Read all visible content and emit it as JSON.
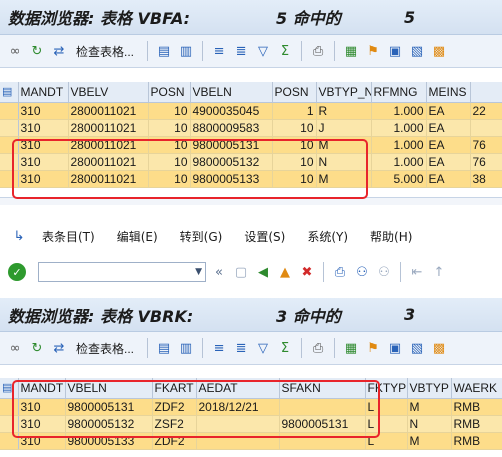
{
  "top": {
    "title": {
      "prefix": "数据浏览器: 表格 VBFA:",
      "count": "5 命中的",
      "total": "5"
    },
    "toolbar": {
      "check_table_label": "检查表格..."
    },
    "columns": [
      "",
      "MANDT",
      "VBELV",
      "POSN",
      "VBELN",
      "POSN",
      "VBTYP_N",
      "RFMNG",
      "MEINS",
      ""
    ],
    "rows": [
      {
        "mandt": "310",
        "vbelv": "2800011021",
        "posnv": "10",
        "vbeln": "4900035045",
        "posnn": "1",
        "vbtyp": "R",
        "rfmng": "1.000",
        "meins": "EA",
        "extra": "22"
      },
      {
        "mandt": "310",
        "vbelv": "2800011021",
        "posnv": "10",
        "vbeln": "8800009583",
        "posnn": "10",
        "vbtyp": "J",
        "rfmng": "1.000",
        "meins": "EA",
        "extra": ""
      },
      {
        "mandt": "310",
        "vbelv": "2800011021",
        "posnv": "10",
        "vbeln": "9800005131",
        "posnn": "10",
        "vbtyp": "M",
        "rfmng": "1.000",
        "meins": "EA",
        "extra": "76"
      },
      {
        "mandt": "310",
        "vbelv": "2800011021",
        "posnv": "10",
        "vbeln": "9800005132",
        "posnn": "10",
        "vbtyp": "N",
        "rfmng": "1.000",
        "meins": "EA",
        "extra": "76"
      },
      {
        "mandt": "310",
        "vbelv": "2800011021",
        "posnv": "10",
        "vbeln": "9800005133",
        "posnn": "10",
        "vbtyp": "M",
        "rfmng": "5.000",
        "meins": "EA",
        "extra": "38"
      }
    ]
  },
  "menu": {
    "items": [
      "表条目(T)",
      "编辑(E)",
      "转到(G)",
      "设置(S)",
      "系统(Y)",
      "帮助(H)"
    ]
  },
  "bottom": {
    "title": {
      "prefix": "数据浏览器: 表格 VBRK:",
      "count": "3 命中的",
      "total": "3"
    },
    "toolbar": {
      "check_table_label": "检查表格..."
    },
    "columns": [
      "",
      "MANDT",
      "VBELN",
      "FKART",
      "AEDAT",
      "SFAKN",
      "FKTYP",
      "VBTYP",
      "WAERK"
    ],
    "rows": [
      {
        "mandt": "310",
        "vbeln": "9800005131",
        "fkart": "ZDF2",
        "aedat": "2018/12/21",
        "sfakn": "",
        "fktyp": "L",
        "vbtyp": "M",
        "waerk": "RMB"
      },
      {
        "mandt": "310",
        "vbeln": "9800005132",
        "fkart": "ZSF2",
        "aedat": "",
        "sfakn": "9800005131",
        "fktyp": "L",
        "vbtyp": "N",
        "waerk": "RMB"
      },
      {
        "mandt": "310",
        "vbeln": "9800005133",
        "fkart": "ZDF2",
        "aedat": "",
        "sfakn": "",
        "fktyp": "L",
        "vbtyp": "M",
        "waerk": "RMB"
      }
    ]
  },
  "colors": {
    "row_bg": "#fddd8a",
    "highlight": "#e8242b",
    "header_bg": "#e4ecf6"
  }
}
